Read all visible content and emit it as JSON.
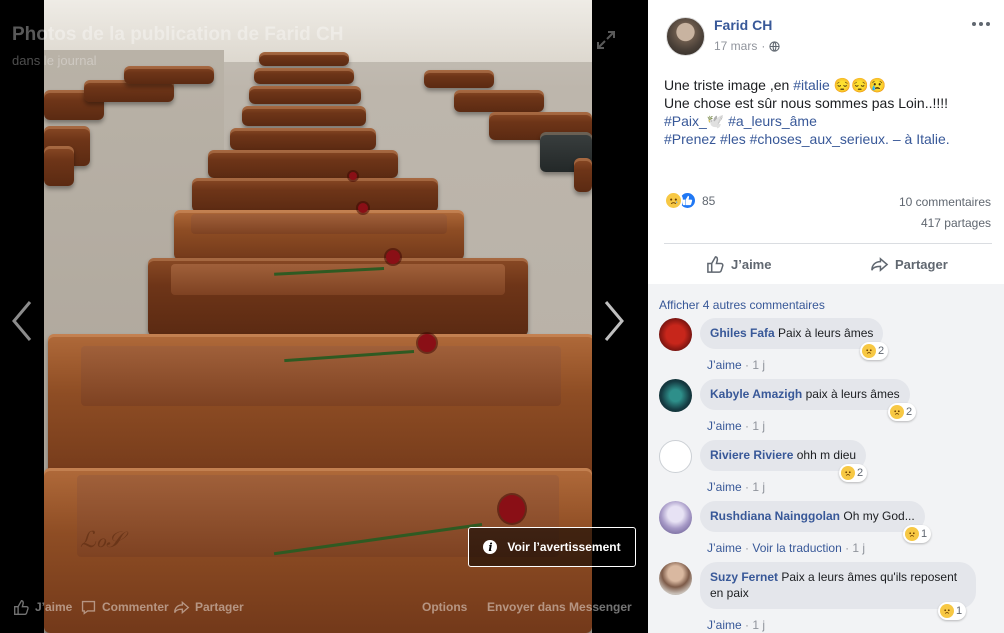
{
  "viewer": {
    "title": "Photos de la publication de Farid CH",
    "subtitle": "dans le journal",
    "warning_label": "Voir l’avertissement",
    "bar": {
      "like": "J’aime",
      "comment": "Commenter",
      "share": "Partager",
      "options": "Options",
      "messenger": "Envoyer dans Messenger"
    }
  },
  "post": {
    "author": "Farid CH",
    "date": "17 mars",
    "line1": "Une triste image ,en",
    "tag_italie": "#italie",
    "emojis1": "😔😔😢",
    "line2": "Une chose est sûr nous sommes pas Loin..!!!!",
    "tag_paix": "#Paix_🕊️",
    "tag_ame": "#a_leurs_âme",
    "tag_prenez": "#Prenez",
    "tag_les": "#les",
    "tag_choses": "#choses_aux_serieux.",
    "location_prefix": "– à",
    "location": "Italie.",
    "reaction_count": "85",
    "comments_count": "10 commentaires",
    "shares_count": "417 partages",
    "like_label": "J’aime",
    "share_label": "Partager"
  },
  "comments": {
    "more": "Afficher 4 autres commentaires",
    "items": [
      {
        "name": "Ghiles Fafa",
        "text": "Paix à leurs âmes",
        "like": "J’aime",
        "time": "1 j",
        "reactions": "2"
      },
      {
        "name": "Kabyle Amazigh",
        "text": "paix à leurs âmes",
        "like": "J’aime",
        "time": "1 j",
        "reactions": "2"
      },
      {
        "name": "Riviere Riviere",
        "text": "ohh m dieu",
        "like": "J’aime",
        "time": "1 j",
        "reactions": "2"
      },
      {
        "name": "Rushdiana Nainggolan",
        "text": "Oh my God...",
        "like": "J’aime",
        "translate": "Voir la traduction",
        "time": "1 j",
        "reactions": "1"
      },
      {
        "name": "Suzy Fernet",
        "text": "Paix a leurs âmes qu'ils reposent en paix",
        "like": "J’aime",
        "time": "1 j",
        "reactions": "1"
      }
    ]
  },
  "colors": {
    "link": "#385898",
    "muted": "#90949c",
    "comment_bg": "#f2f3f5"
  },
  "icons": [
    "expand-icon",
    "prev-arrow-icon",
    "next-arrow-icon",
    "info-icon",
    "like-icon",
    "comment-icon",
    "share-icon",
    "globe-icon",
    "more-icon",
    "sad-reaction-icon",
    "like-reaction-icon"
  ]
}
